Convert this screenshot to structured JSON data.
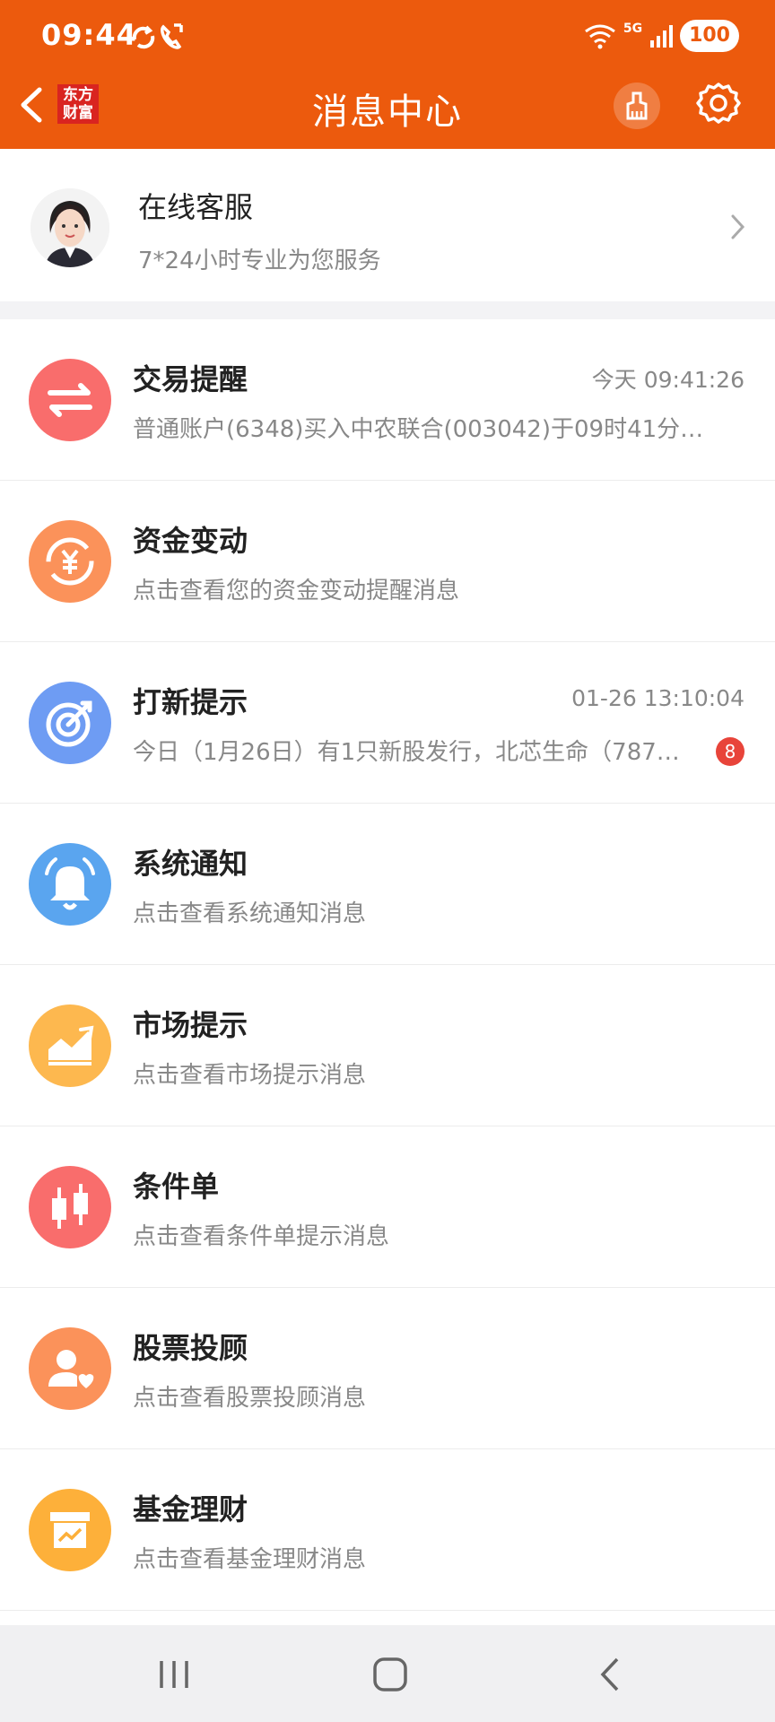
{
  "status": {
    "time": "09:44",
    "network": "5G",
    "battery": "100"
  },
  "header": {
    "brand_line1": "东方",
    "brand_line2": "财富",
    "title": "消息中心"
  },
  "service": {
    "title": "在线客服",
    "subtitle": "7*24小时专业为您服务"
  },
  "messages": [
    {
      "title": "交易提醒",
      "time": "今天 09:41:26",
      "subtitle": "普通账户(6348)买入中农联合(003042)于09时41分…",
      "icon": "exchange-arrows-icon",
      "color": "#f96d6c"
    },
    {
      "title": "资金变动",
      "time": "",
      "subtitle": "点击查看您的资金变动提醒消息",
      "icon": "yen-cycle-icon",
      "color": "#fb925a"
    },
    {
      "title": "打新提示",
      "time": "01-26 13:10:04",
      "subtitle": "今日（1月26日）有1只新股发行，北芯生命（787…",
      "badge": "8",
      "icon": "target-icon",
      "color": "#6e9cf3"
    },
    {
      "title": "系统通知",
      "time": "",
      "subtitle": "点击查看系统通知消息",
      "icon": "bell-icon",
      "color": "#5aa5ef"
    },
    {
      "title": "市场提示",
      "time": "",
      "subtitle": "点击查看市场提示消息",
      "icon": "trend-chart-icon",
      "color": "#fdb84f"
    },
    {
      "title": "条件单",
      "time": "",
      "subtitle": "点击查看条件单提示消息",
      "icon": "candlestick-icon",
      "color": "#f96d6c"
    },
    {
      "title": "股票投顾",
      "time": "",
      "subtitle": "点击查看股票投顾消息",
      "icon": "advisor-icon",
      "color": "#fb925a"
    },
    {
      "title": "基金理财",
      "time": "",
      "subtitle": "点击查看基金理财消息",
      "icon": "fund-icon",
      "color": "#fdb03a"
    }
  ]
}
